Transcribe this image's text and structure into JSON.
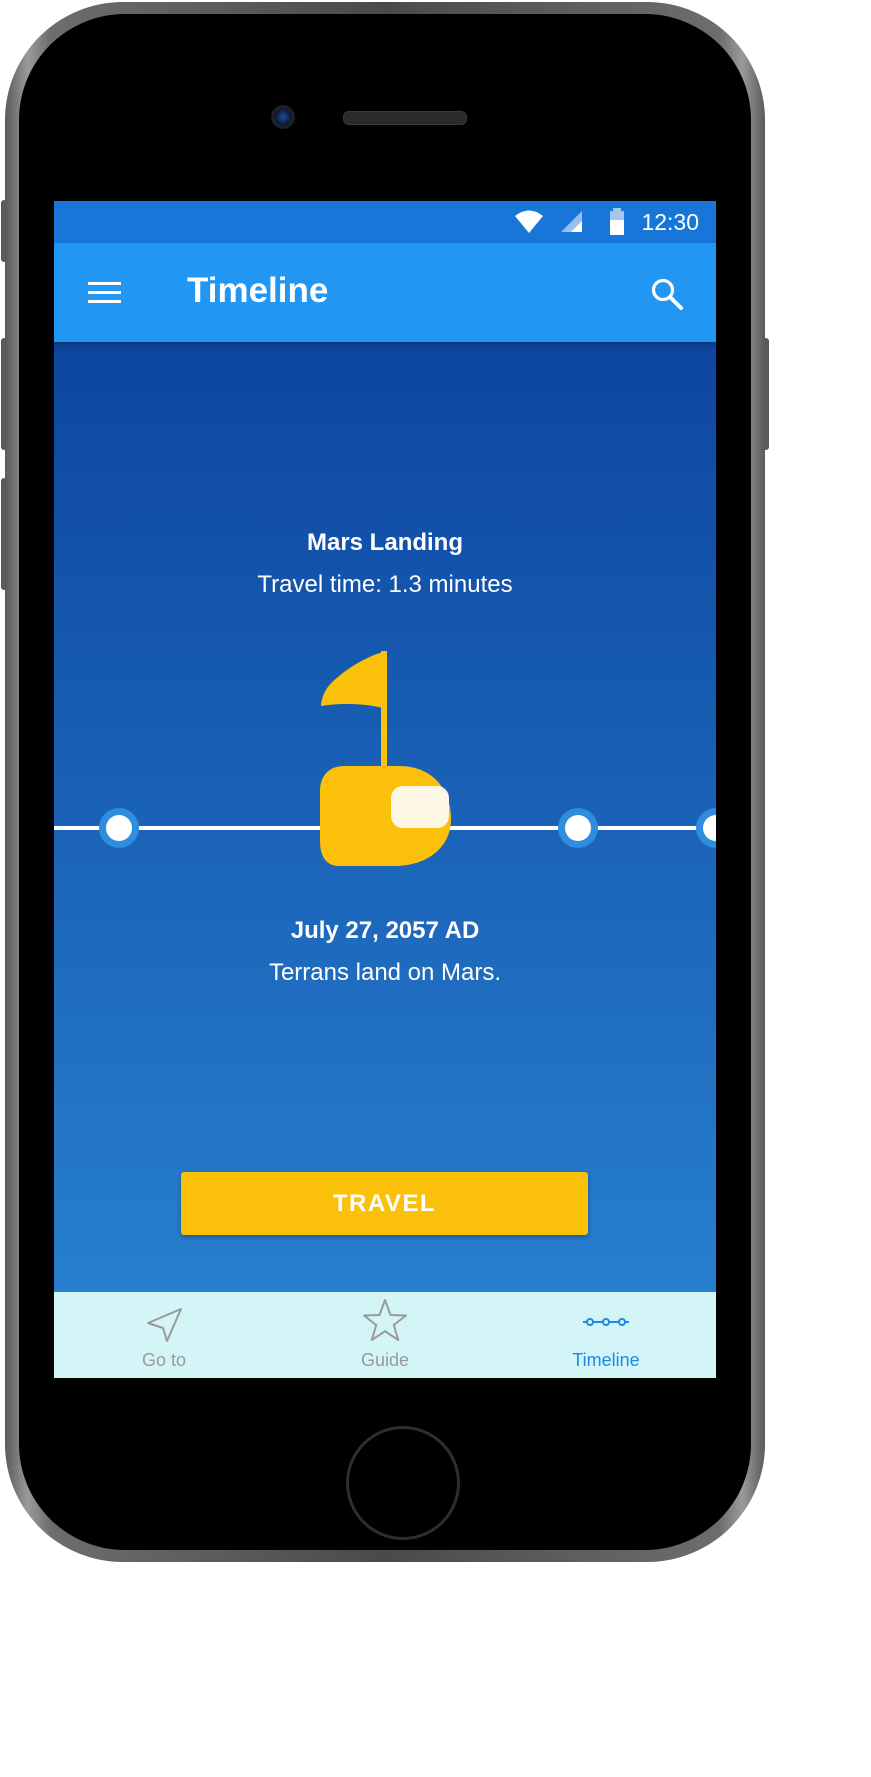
{
  "status_bar": {
    "time": "12:30",
    "icons": [
      "wifi-icon",
      "cellular-signal-icon",
      "battery-icon"
    ]
  },
  "app_bar": {
    "title": "Timeline",
    "menu_icon": "hamburger-menu-icon",
    "search_icon": "search-icon"
  },
  "event": {
    "title": "Mars Landing",
    "travel_time": "Travel time: 1.3 minutes",
    "icon": "flag-marker-icon",
    "date": "July 27, 2057 AD",
    "description": "Terrans land on Mars."
  },
  "action": {
    "travel_label": "TRAVEL"
  },
  "bottom_nav": {
    "items": [
      {
        "label": "Go to",
        "icon": "navigation-arrow-icon",
        "active": false
      },
      {
        "label": "Guide",
        "icon": "star-icon",
        "active": false
      },
      {
        "label": "Timeline",
        "icon": "timeline-icon",
        "active": true
      }
    ]
  },
  "colors": {
    "app_bar": "#2196f3",
    "status_bar": "#1776d8",
    "accent": "#fbc00a",
    "nav_background": "#d4f5f7",
    "nav_active": "#1e88e5",
    "nav_inactive": "#9a9a9a"
  }
}
